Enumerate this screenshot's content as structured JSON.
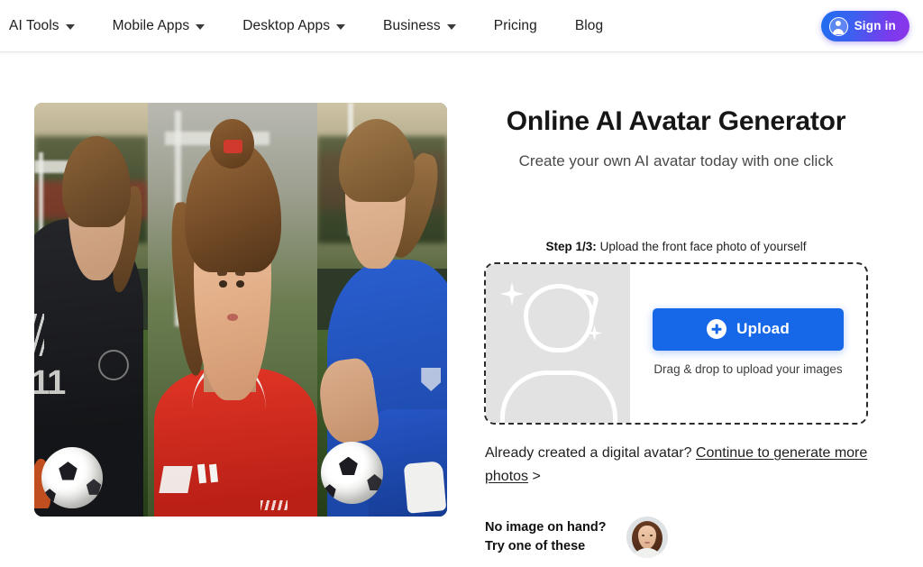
{
  "header": {
    "nav_items": [
      {
        "label": "AI Tools",
        "has_caret": true,
        "icon": "chevron-down-icon"
      },
      {
        "label": "Mobile Apps",
        "has_caret": true,
        "icon": "chevron-down-icon"
      },
      {
        "label": "Desktop Apps",
        "has_caret": true,
        "icon": "chevron-down-icon"
      },
      {
        "label": "Business",
        "has_caret": true,
        "icon": "chevron-down-icon"
      },
      {
        "label": "Pricing",
        "has_caret": false,
        "icon": ""
      },
      {
        "label": "Blog",
        "has_caret": false,
        "icon": ""
      }
    ],
    "signin": {
      "label": "Sign in",
      "icon": "user-circle-icon",
      "gradient_start": "#1f6ef0",
      "gradient_end": "#8b35e8"
    }
  },
  "hero": {
    "title": "Online AI Avatar Generator",
    "subtitle": "Create your own AI avatar today with one click"
  },
  "collage": {
    "alt": "Three AI-generated female soccer player avatars on a field",
    "panels": [
      {
        "kit_color": "#1a1b1f",
        "jersey_number": "11",
        "description": "player in black kit with soccer ball"
      },
      {
        "kit_color": "#d62b1e",
        "jersey_number": "",
        "description": "close-up portrait of player in red kit"
      },
      {
        "kit_color": "#2458c4",
        "jersey_number": "",
        "description": "player in blue kit crouching with soccer ball"
      }
    ]
  },
  "upload": {
    "step_prefix": "Step 1/3:",
    "step_text": " Upload the front face photo of yourself",
    "thumb_icon": "avatar-placeholder-icon",
    "sparkle_icon": "sparkle-icon",
    "button_label": "Upload",
    "button_icon": "plus-circle-icon",
    "button_color": "#1668e8",
    "drag_hint": "Drag & drop to upload your images",
    "placeholder_bg": "#e2e2e2"
  },
  "already": {
    "prefix": "Already created a digital avatar? ",
    "link_text": "Continue to generate more photos",
    "arrow": " >"
  },
  "no_image": {
    "line1": "No image on hand?",
    "line2": "Try one of these",
    "sample_alt": "Sample portrait of a woman with brown hair"
  }
}
